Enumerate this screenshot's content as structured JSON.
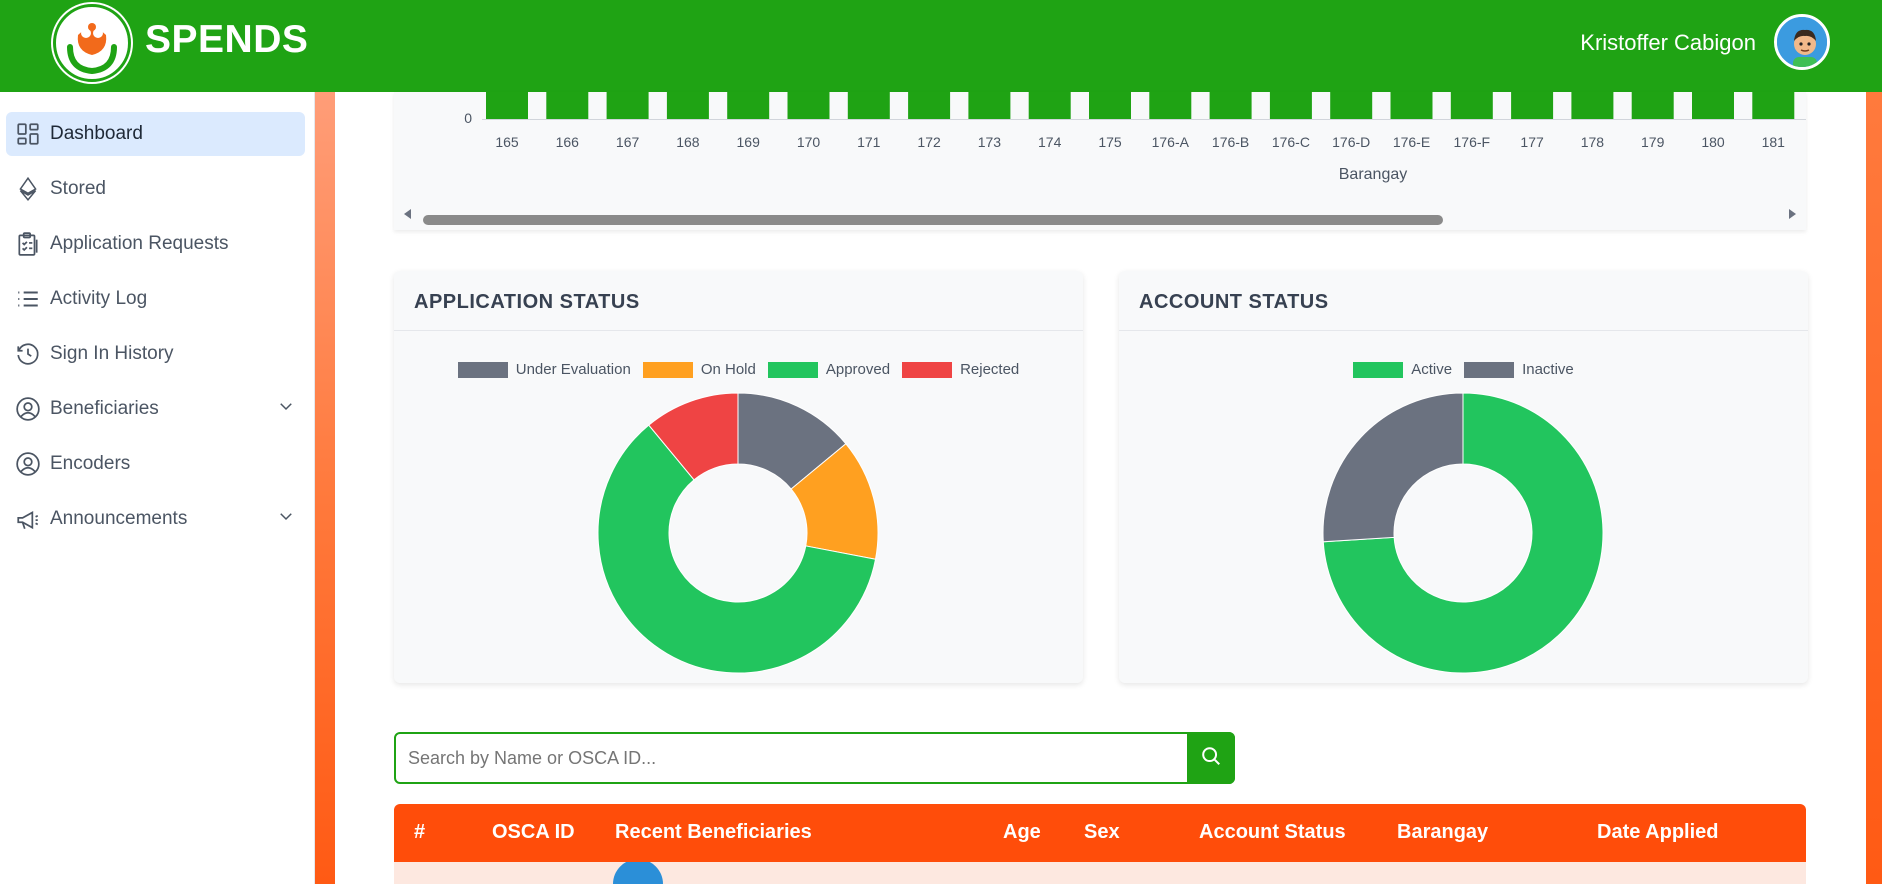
{
  "header": {
    "brand": "SPENDS",
    "user_name": "Kristoffer Cabigon"
  },
  "sidebar": {
    "items": [
      {
        "label": "Dashboard",
        "icon": "dashboard-icon",
        "active": true
      },
      {
        "label": "Stored",
        "icon": "ethereum-icon"
      },
      {
        "label": "Application Requests",
        "icon": "clipboard-icon"
      },
      {
        "label": "Activity Log",
        "icon": "list-icon"
      },
      {
        "label": "Sign In History",
        "icon": "history-icon"
      },
      {
        "label": "Beneficiaries",
        "icon": "user-circle-icon",
        "expandable": true
      },
      {
        "label": "Encoders",
        "icon": "user-circle-icon"
      },
      {
        "label": "Announcements",
        "icon": "megaphone-icon",
        "expandable": true
      }
    ]
  },
  "colors": {
    "brand_green": "#1fa314",
    "table_orange": "#ff4d0a",
    "under_evaluation": "#6b7280",
    "on_hold": "#ffa020",
    "approved": "#22c55e",
    "rejected": "#ef4444"
  },
  "chart_data": [
    {
      "type": "bar",
      "xlabel": "Barangay",
      "y_ticks": [
        "0"
      ],
      "categories": [
        "165",
        "166",
        "167",
        "168",
        "169",
        "170",
        "171",
        "172",
        "173",
        "174",
        "175",
        "176-A",
        "176-B",
        "176-C",
        "176-D",
        "176-E",
        "176-F",
        "177",
        "178",
        "179",
        "180",
        "181"
      ]
    },
    {
      "type": "pie",
      "title": "APPLICATION STATUS",
      "labels": [
        "Under Evaluation",
        "On Hold",
        "Approved",
        "Rejected"
      ],
      "values": [
        14,
        14,
        61,
        11
      ],
      "colors": [
        "#6b7280",
        "#ffa020",
        "#22c55e",
        "#ef4444"
      ]
    },
    {
      "type": "pie",
      "title": "ACCOUNT STATUS",
      "labels": [
        "Active",
        "Inactive"
      ],
      "values": [
        74,
        26
      ],
      "colors": [
        "#22c55e",
        "#6b7280"
      ]
    }
  ],
  "search": {
    "placeholder": "Search by Name or OSCA ID..."
  },
  "table": {
    "columns": [
      "#",
      "OSCA ID",
      "Recent Beneficiaries",
      "Age",
      "Sex",
      "Account Status",
      "Barangay",
      "Date Applied"
    ]
  }
}
